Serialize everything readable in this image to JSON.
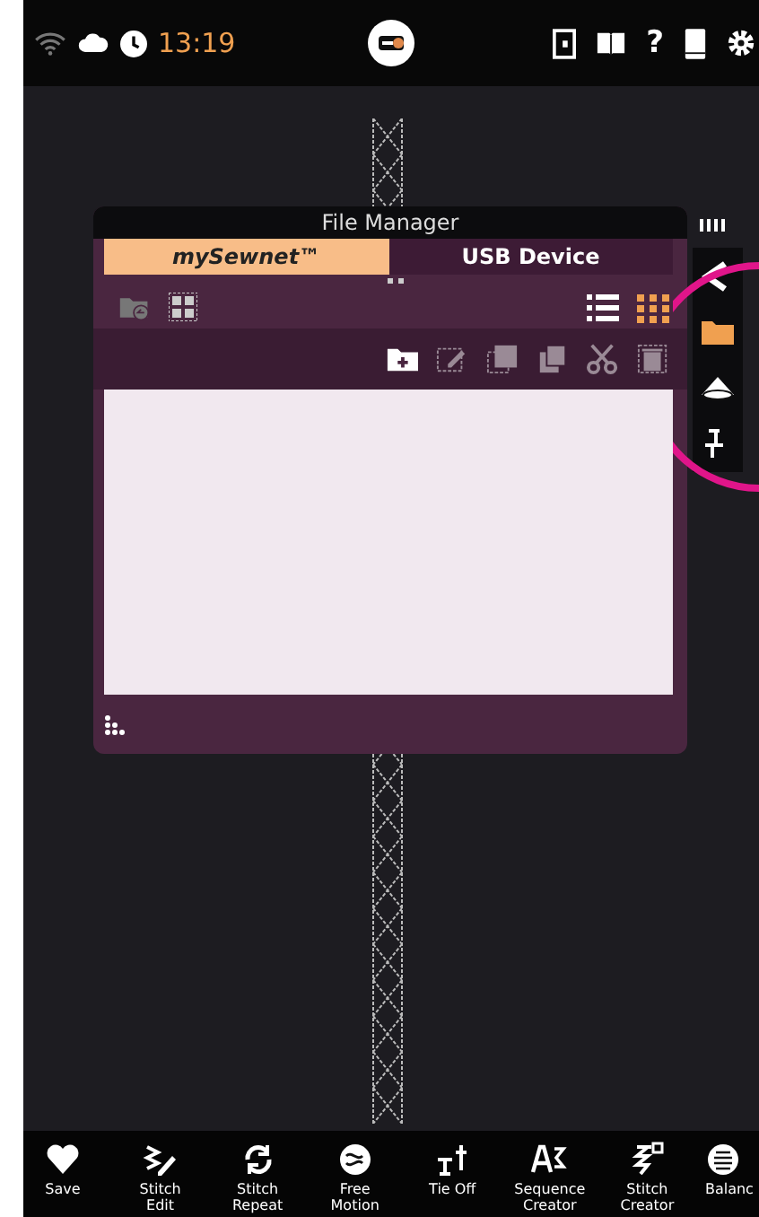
{
  "status_bar": {
    "time": "13:19",
    "help": "?"
  },
  "file_manager": {
    "title": "File Manager",
    "tabs": [
      {
        "label": "mySewnet™",
        "selected": true
      },
      {
        "label": "USB Device",
        "selected": false
      }
    ],
    "views": [
      {
        "kind": "list",
        "selected": false
      },
      {
        "kind": "grid",
        "selected": true
      }
    ],
    "actions": [
      {
        "kind": "new-folder",
        "disabled": false
      },
      {
        "kind": "rename",
        "disabled": true
      },
      {
        "kind": "copy",
        "disabled": true
      },
      {
        "kind": "paste",
        "disabled": true
      },
      {
        "kind": "cut",
        "disabled": true
      },
      {
        "kind": "delete",
        "disabled": true
      }
    ]
  },
  "side_panel": [
    {
      "kind": "collapse",
      "selected": false
    },
    {
      "kind": "folder",
      "selected": true
    },
    {
      "kind": "lamp",
      "selected": false
    },
    {
      "kind": "stitch",
      "selected": false
    }
  ],
  "toolbar": [
    {
      "kind": "heart",
      "label": "Save"
    },
    {
      "kind": "edit",
      "label": "Stitch\nEdit"
    },
    {
      "kind": "repeat",
      "label": "Stitch\nRepeat"
    },
    {
      "kind": "motion",
      "label": "Free\nMotion"
    },
    {
      "kind": "tie",
      "label": "Tie Off"
    },
    {
      "kind": "seq",
      "label": "Sequence\nCreator"
    },
    {
      "kind": "creator",
      "label": "Stitch\nCreator"
    },
    {
      "kind": "balance",
      "label": "Balanc"
    }
  ]
}
